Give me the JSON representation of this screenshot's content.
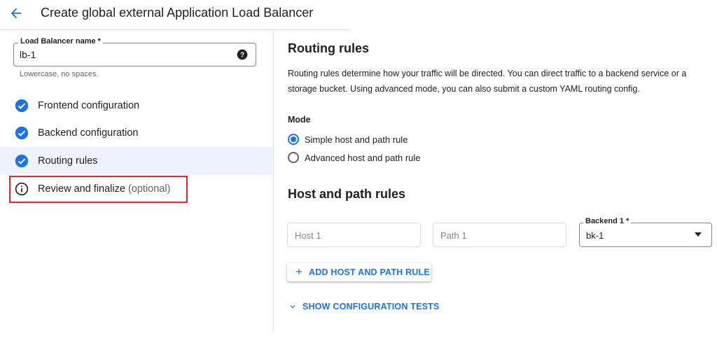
{
  "header": {
    "title": "Create global external Application Load Balancer"
  },
  "lb_name": {
    "label": "Load Balancer name *",
    "value": "lb-1",
    "hint": "Lowercase, no spaces."
  },
  "steps": [
    {
      "label": "Frontend configuration",
      "status": "done"
    },
    {
      "label": "Backend configuration",
      "status": "done"
    },
    {
      "label": "Routing rules",
      "status": "done"
    },
    {
      "label": "Review and finalize",
      "suffix": "(optional)",
      "status": "info"
    }
  ],
  "routing": {
    "title": "Routing rules",
    "description": "Routing rules determine how your traffic will be directed. You can direct traffic to a backend service or a storage bucket. Using advanced mode, you can also submit a custom YAML routing config.",
    "mode_label": "Mode",
    "modes": [
      {
        "label": "Simple host and path rule",
        "checked": true
      },
      {
        "label": "Advanced host and path rule",
        "checked": false
      }
    ]
  },
  "host_path": {
    "title": "Host and path rules",
    "host_placeholder": "Host 1",
    "path_placeholder": "Path 1",
    "backend_label": "Backend 1 *",
    "backend_value": "bk-1",
    "add_button": "ADD HOST AND PATH RULE",
    "show_tests": "SHOW CONFIGURATION TESTS"
  },
  "colors": {
    "accent": "#1a73e8",
    "highlight": "#e3262c",
    "active_bg": "#eef3fd"
  }
}
